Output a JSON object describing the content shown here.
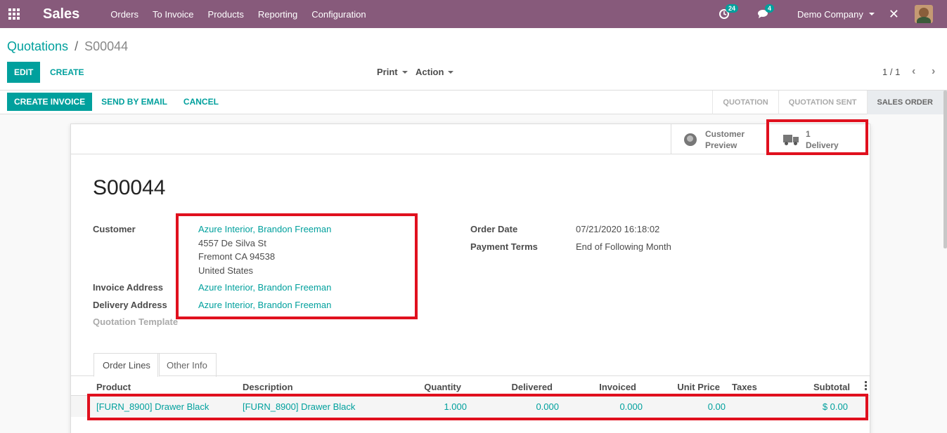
{
  "navbar": {
    "app_title": "Sales",
    "menu": [
      "Orders",
      "To Invoice",
      "Products",
      "Reporting",
      "Configuration"
    ],
    "activity_count": "24",
    "message_count": "4",
    "company": "Demo Company"
  },
  "breadcrumb": {
    "parent": "Quotations",
    "separator": "/",
    "current": "S00044"
  },
  "toolbar": {
    "edit_label": "EDIT",
    "create_label": "CREATE",
    "print_label": "Print",
    "action_label": "Action",
    "pager": "1 / 1"
  },
  "statusbar": {
    "create_invoice": "CREATE INVOICE",
    "send_by_email": "SEND BY EMAIL",
    "cancel": "CANCEL",
    "stages": [
      "QUOTATION",
      "QUOTATION SENT",
      "SALES ORDER"
    ],
    "active_stage": "SALES ORDER"
  },
  "smart_buttons": {
    "customer_preview_line1": "Customer",
    "customer_preview_line2": "Preview",
    "delivery_count": "1",
    "delivery_label": "Delivery"
  },
  "order": {
    "name": "S00044",
    "customer_label": "Customer",
    "customer": "Azure Interior, Brandon Freeman",
    "address_line1": "4557 De Silva St",
    "address_line2": "Fremont CA 94538",
    "address_line3": "United States",
    "invoice_address_label": "Invoice Address",
    "invoice_address": "Azure Interior, Brandon Freeman",
    "delivery_address_label": "Delivery Address",
    "delivery_address": "Azure Interior, Brandon Freeman",
    "quotation_template_label": "Quotation Template",
    "order_date_label": "Order Date",
    "order_date": "07/21/2020 16:18:02",
    "payment_terms_label": "Payment Terms",
    "payment_terms": "End of Following Month"
  },
  "tabs": {
    "order_lines": "Order Lines",
    "other_info": "Other Info"
  },
  "table": {
    "columns": [
      "Product",
      "Description",
      "Quantity",
      "Delivered",
      "Invoiced",
      "Unit Price",
      "Taxes",
      "Subtotal"
    ],
    "rows": [
      {
        "product": "[FURN_8900] Drawer Black",
        "description": "[FURN_8900] Drawer Black",
        "quantity": "1.000",
        "delivered": "0.000",
        "invoiced": "0.000",
        "unit_price": "0.00",
        "taxes": "",
        "subtotal": "$ 0.00"
      }
    ]
  },
  "colors": {
    "navbar": "#875a7b",
    "accent": "#00a09d",
    "highlight": "#e0101e"
  }
}
